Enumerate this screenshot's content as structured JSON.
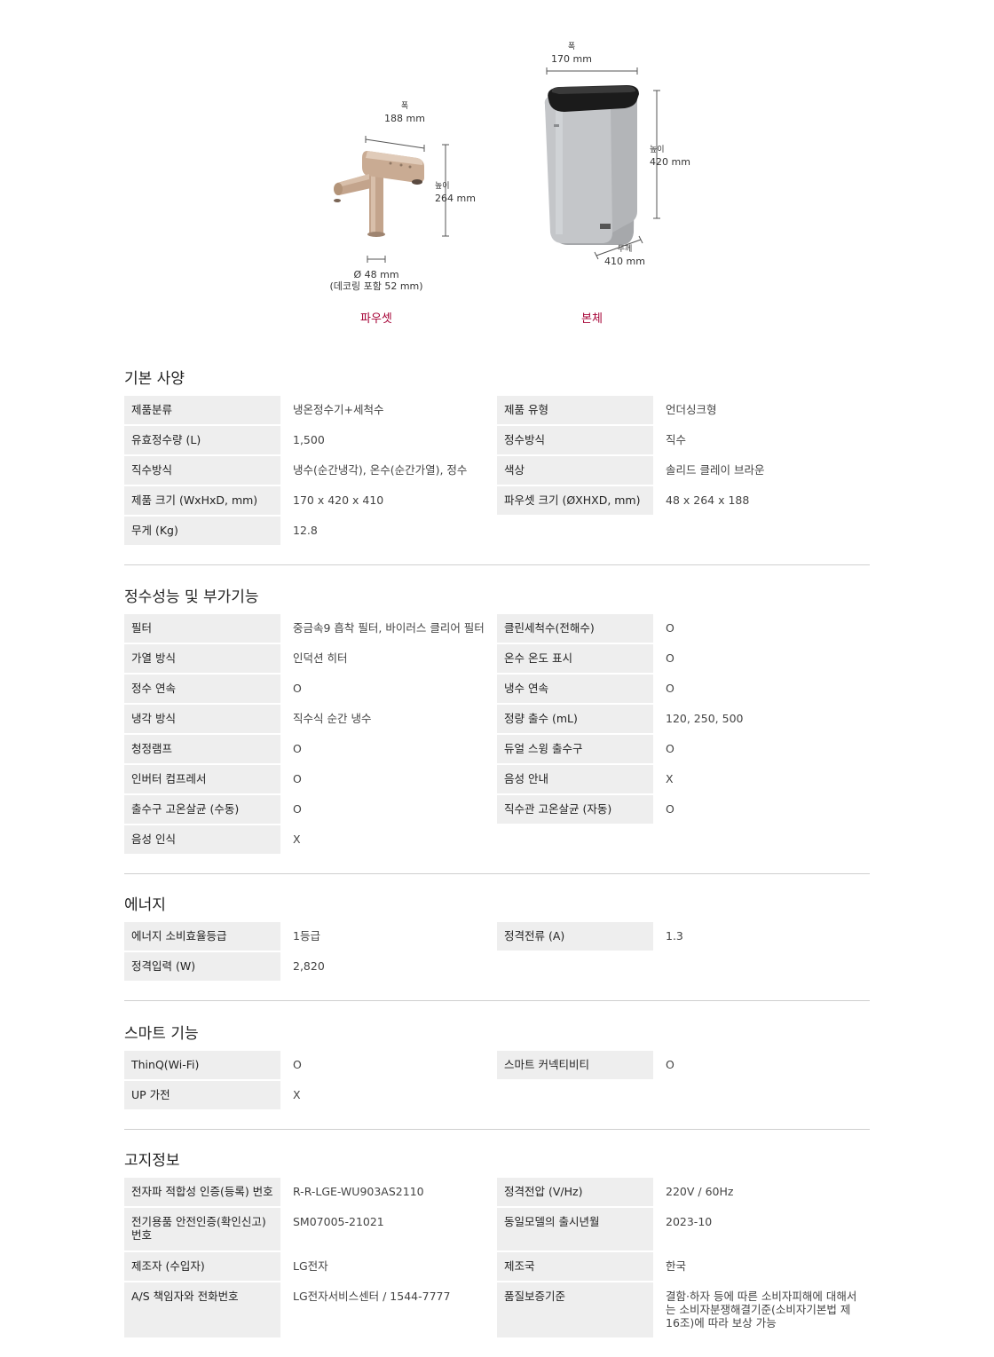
{
  "hero": {
    "faucet": {
      "width_label": "폭",
      "width_value": "188 mm",
      "height_label": "높이",
      "height_value": "264 mm",
      "diameter_value": "Ø 48 mm",
      "diameter_note": "(데코링 포함 52 mm)",
      "caption": "파우셋"
    },
    "body": {
      "width_label": "폭",
      "width_value": "170 mm",
      "height_label": "높이",
      "height_value": "420 mm",
      "depth_label": "두께",
      "depth_value": "410 mm",
      "caption": "본체"
    },
    "colors": {
      "accent": "#a50034",
      "faucet": "#c9ab93",
      "body": "#b9bbbe",
      "top": "#1b1b1b"
    }
  },
  "sections": [
    {
      "title": "기본 사양",
      "rows": [
        [
          {
            "label": "제품분류",
            "value": "냉온정수기+세척수"
          },
          {
            "label": "제품 유형",
            "value": "언더싱크형"
          }
        ],
        [
          {
            "label": "유효정수량 (L)",
            "value": "1,500"
          },
          {
            "label": "정수방식",
            "value": "직수"
          }
        ],
        [
          {
            "label": "직수방식",
            "value": "냉수(순간냉각), 온수(순간가열), 정수"
          },
          {
            "label": "색상",
            "value": "솔리드 클레이 브라운"
          }
        ],
        [
          {
            "label": "제품 크기 (WxHxD, mm)",
            "value": "170 x 420 x 410"
          },
          {
            "label": "파우셋 크기 (ØXHXD, mm)",
            "value": "48 x 264 x 188"
          }
        ],
        [
          {
            "label": "무게 (Kg)",
            "value": "12.8"
          }
        ]
      ]
    },
    {
      "title": "정수성능 및 부가기능",
      "rows": [
        [
          {
            "label": "필터",
            "value": "중금속9 흡착 필터, 바이러스 클리어 필터"
          },
          {
            "label": "클린세척수(전해수)",
            "value": "O"
          }
        ],
        [
          {
            "label": "가열 방식",
            "value": "인덕션 히터"
          },
          {
            "label": "온수 온도 표시",
            "value": "O"
          }
        ],
        [
          {
            "label": "정수 연속",
            "value": "O"
          },
          {
            "label": "냉수 연속",
            "value": "O"
          }
        ],
        [
          {
            "label": "냉각 방식",
            "value": "직수식 순간 냉수"
          },
          {
            "label": "정량 출수 (mL)",
            "value": "120, 250, 500"
          }
        ],
        [
          {
            "label": "청정램프",
            "value": "O"
          },
          {
            "label": "듀얼 스윙 출수구",
            "value": "O"
          }
        ],
        [
          {
            "label": "인버터 컴프레서",
            "value": "O"
          },
          {
            "label": "음성 안내",
            "value": "X"
          }
        ],
        [
          {
            "label": "출수구 고온살균 (수동)",
            "value": "O"
          },
          {
            "label": "직수관 고온살균 (자동)",
            "value": "O"
          }
        ],
        [
          {
            "label": "음성 인식",
            "value": "X"
          }
        ]
      ]
    },
    {
      "title": "에너지",
      "rows": [
        [
          {
            "label": "에너지 소비효율등급",
            "value": "1등급"
          },
          {
            "label": "정격전류 (A)",
            "value": "1.3"
          }
        ],
        [
          {
            "label": "정격입력 (W)",
            "value": "2,820"
          }
        ]
      ]
    },
    {
      "title": "스마트 기능",
      "rows": [
        [
          {
            "label": "ThinQ(Wi-Fi)",
            "value": "O"
          },
          {
            "label": "스마트 커넥티비티",
            "value": "O"
          }
        ],
        [
          {
            "label": "UP 가전",
            "value": "X"
          }
        ]
      ]
    },
    {
      "title": "고지정보",
      "rows": [
        [
          {
            "label": "전자파 적합성 인증(등록) 번호",
            "value": "R-R-LGE-WU903AS2110"
          },
          {
            "label": "정격전압 (V/Hz)",
            "value": "220V / 60Hz"
          }
        ],
        [
          {
            "label": "전기용품 안전인증(확인신고) 번호",
            "value": "SM07005-21021"
          },
          {
            "label": "동일모델의 출시년월",
            "value": "2023-10"
          }
        ],
        [
          {
            "label": "제조자 (수입자)",
            "value": "LG전자"
          },
          {
            "label": "제조국",
            "value": "한국"
          }
        ],
        [
          {
            "label": "A/S 책임자와 전화번호",
            "value": "LG전자서비스센터 / 1544-7777"
          },
          {
            "label": "품질보증기준",
            "value": "결함·하자 등에 따른 소비자피해에 대해서는 소비자분쟁해결기준(소비자기본법 제16조)에 따라 보상 가능"
          }
        ]
      ]
    }
  ]
}
